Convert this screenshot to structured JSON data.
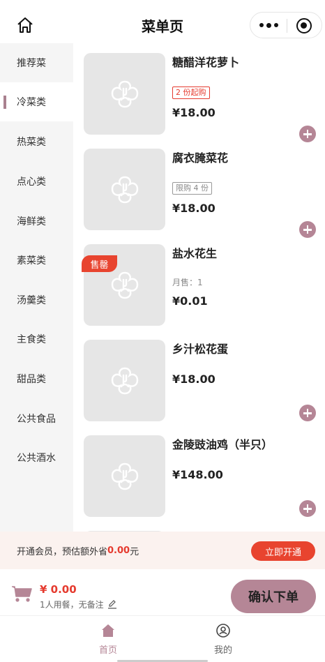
{
  "header": {
    "title": "菜单页"
  },
  "sidebar": {
    "categories": [
      "推荐菜",
      "冷菜类",
      "热菜类",
      "点心类",
      "海鲜类",
      "素菜类",
      "汤羹类",
      "主食类",
      "甜品类",
      "公共食品",
      "公共酒水"
    ],
    "active_index": 1
  },
  "products": [
    {
      "name": "糖醋洋花萝卜",
      "tag": "2 份起购",
      "price": "¥18.00"
    },
    {
      "name": "腐衣腌菜花",
      "tag": "限购 4 份",
      "price": "¥18.00"
    },
    {
      "name": "盐水花生",
      "badge": "售罄",
      "sales": "月售：1",
      "price": "¥0.01"
    },
    {
      "name": "乡汁松花蛋",
      "price": "¥18.00"
    },
    {
      "name": "金陵豉油鸡（半只）",
      "price": "¥148.00"
    }
  ],
  "member_bar": {
    "text_before": "开通会员，预估额外省",
    "amount": "0.00",
    "unit": " 元",
    "button": "立即开通"
  },
  "cart": {
    "total": "¥ 0.00",
    "note": "1人用餐，无备注",
    "confirm_label": "确认下单"
  },
  "tabbar": {
    "home_label": "首页",
    "mine_label": "我的"
  },
  "colors": {
    "accent": "#b58696",
    "red": "#e8442f",
    "sidebar_bg": "#f5f5f5"
  },
  "icons": [
    "home-icon",
    "more-icon",
    "target-icon",
    "placeholder-logo-icon",
    "add-icon",
    "cart-icon",
    "edit-icon",
    "tab-home-icon",
    "tab-user-icon"
  ]
}
